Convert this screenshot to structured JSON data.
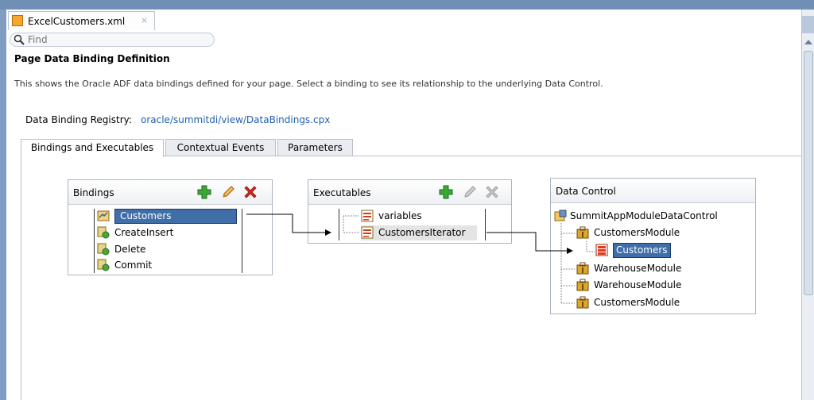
{
  "editor_tab": {
    "title": "ExcelCustomers.xml",
    "close": "×"
  },
  "find": {
    "placeholder": "Find"
  },
  "page": {
    "title": "Page Data Binding Definition",
    "description": "This shows the Oracle ADF data bindings defined for your page. Select a binding to see its relationship to the underlying Data Control.",
    "registry_label": "Data Binding Registry:",
    "registry_link": "oracle/summitdi/view/DataBindings.cpx"
  },
  "tabs": [
    {
      "label": "Bindings and Executables",
      "active": true
    },
    {
      "label": "Contextual Events",
      "active": false
    },
    {
      "label": "Parameters",
      "active": false
    }
  ],
  "bindings_panel": {
    "title": "Bindings",
    "items": [
      {
        "label": "Customers",
        "icon": "binding-iterator-icon",
        "selected": true
      },
      {
        "label": "CreateInsert",
        "icon": "action-binding-icon",
        "selected": false
      },
      {
        "label": "Delete",
        "icon": "action-binding-icon",
        "selected": false
      },
      {
        "label": "Commit",
        "icon": "action-binding-icon",
        "selected": false
      }
    ]
  },
  "executables_panel": {
    "title": "Executables",
    "items": [
      {
        "label": "variables",
        "icon": "variables-icon",
        "selected": false
      },
      {
        "label": "CustomersIterator",
        "icon": "iterator-icon",
        "selected": true
      }
    ]
  },
  "datacontrol_panel": {
    "title": "Data Control",
    "root": "SummitAppModuleDataControl",
    "items": [
      {
        "label": "CustomersModule",
        "icon": "module-icon",
        "selected": false
      },
      {
        "label": "Customers",
        "icon": "viewobject-icon",
        "selected": true
      },
      {
        "label": "WarehouseModule",
        "icon": "module-icon",
        "selected": false
      },
      {
        "label": "WarehouseModule",
        "icon": "module-icon",
        "selected": false
      },
      {
        "label": "CustomersModule",
        "icon": "module-icon",
        "selected": false
      }
    ]
  },
  "colors": {
    "selection": "#3f6ea8",
    "link": "#2060b0",
    "add": "#3aa832",
    "delete": "#d42a1a",
    "edit": "#d08a1c"
  }
}
